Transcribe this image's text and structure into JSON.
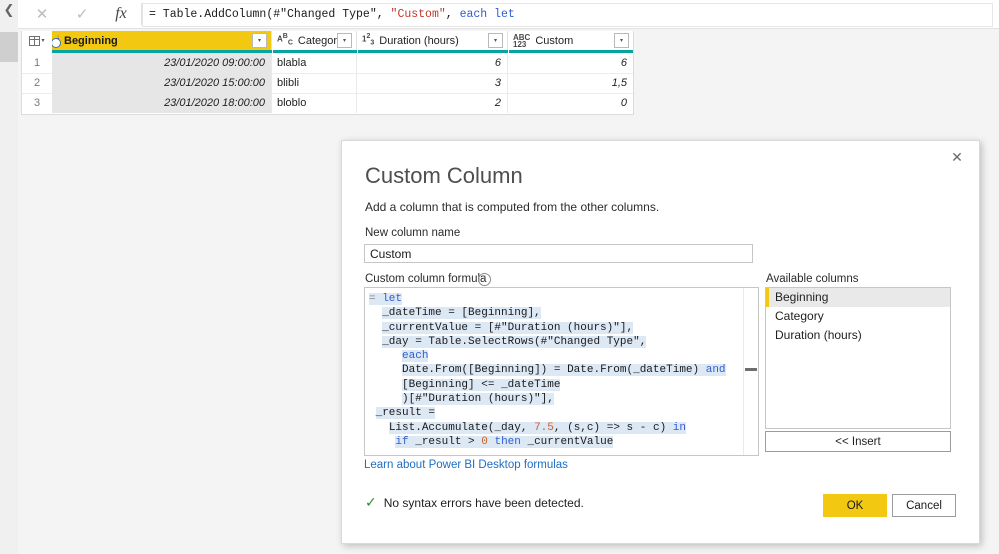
{
  "rail": {
    "collapse_icon": "❮"
  },
  "formula_bar": {
    "cancel_icon": "✕",
    "accept_icon": "✓",
    "fx_label": "fx",
    "segments": [
      {
        "text": "= Table.AddColumn(#\"Changed Type\", ",
        "kind": "plain"
      },
      {
        "text": "\"Custom\"",
        "kind": "string"
      },
      {
        "text": ", ",
        "kind": "plain"
      },
      {
        "text": "each let",
        "kind": "keyword"
      }
    ],
    "full_text": "= Table.AddColumn(#\"Changed Type\", \"Custom\", each let"
  },
  "grid": {
    "corner_caret": "▾",
    "dropdown_caret": "▾",
    "columns": [
      {
        "name": "Beginning",
        "type_icon": "datetime",
        "type_icon_text": "",
        "selected": true
      },
      {
        "name": "Category",
        "type_icon": "text",
        "type_icon_text": "ABC",
        "selected": false
      },
      {
        "name": "Duration (hours)",
        "type_icon": "number",
        "type_icon_text": "123",
        "selected": false
      },
      {
        "name": "Custom",
        "type_icon": "any",
        "type_icon_text": "ABC123",
        "selected": false
      }
    ],
    "rows": [
      {
        "num": "1",
        "beginning": "23/01/2020 09:00:00",
        "category": "blabla",
        "duration": "6",
        "custom": "6"
      },
      {
        "num": "2",
        "beginning": "23/01/2020 15:00:00",
        "category": "blibli",
        "duration": "3",
        "custom": "1,5"
      },
      {
        "num": "3",
        "beginning": "23/01/2020 18:00:00",
        "category": "bloblo",
        "duration": "2",
        "custom": "0"
      }
    ]
  },
  "dialog": {
    "close_icon": "✕",
    "title": "Custom Column",
    "subtitle": "Add a column that is computed from the other columns.",
    "new_column_label": "New column name",
    "new_column_value": "Custom",
    "formula_label": "Custom column formula",
    "info_icon": "i",
    "formula_text": "= let\n  _dateTime = [Beginning],\n  _currentValue = [#\"Duration (hours)\"],\n  _day = Table.SelectRows(#\"Changed Type\",\n     each\n     Date.From([Beginning]) = Date.From(_dateTime) and\n     [Beginning] <= _dateTime\n     )[#\"Duration (hours)\"],\n _result =\n   List.Accumulate(_day, 7.5, (s,c) => s - c) in\n    if _result > 0 then _currentValue",
    "learn_link": "Learn about Power BI Desktop formulas",
    "available_columns_label": "Available columns",
    "available_columns": [
      {
        "name": "Beginning",
        "selected": true
      },
      {
        "name": "Category",
        "selected": false
      },
      {
        "name": "Duration (hours)",
        "selected": false
      }
    ],
    "insert_label": "<< Insert",
    "status_icon": "✓",
    "status_text": "No syntax errors have been detected.",
    "ok_label": "OK",
    "cancel_label": "Cancel"
  },
  "colors": {
    "accent_yellow": "#f2c811",
    "teal_underline": "#07a5a0",
    "link_blue": "#1e6fc4",
    "success_green": "#2e8b35",
    "keyword_blue": "#2f5fd0",
    "string_red": "#c0392b",
    "number_orange": "#c0622b",
    "code_highlight": "#dde8f5"
  }
}
